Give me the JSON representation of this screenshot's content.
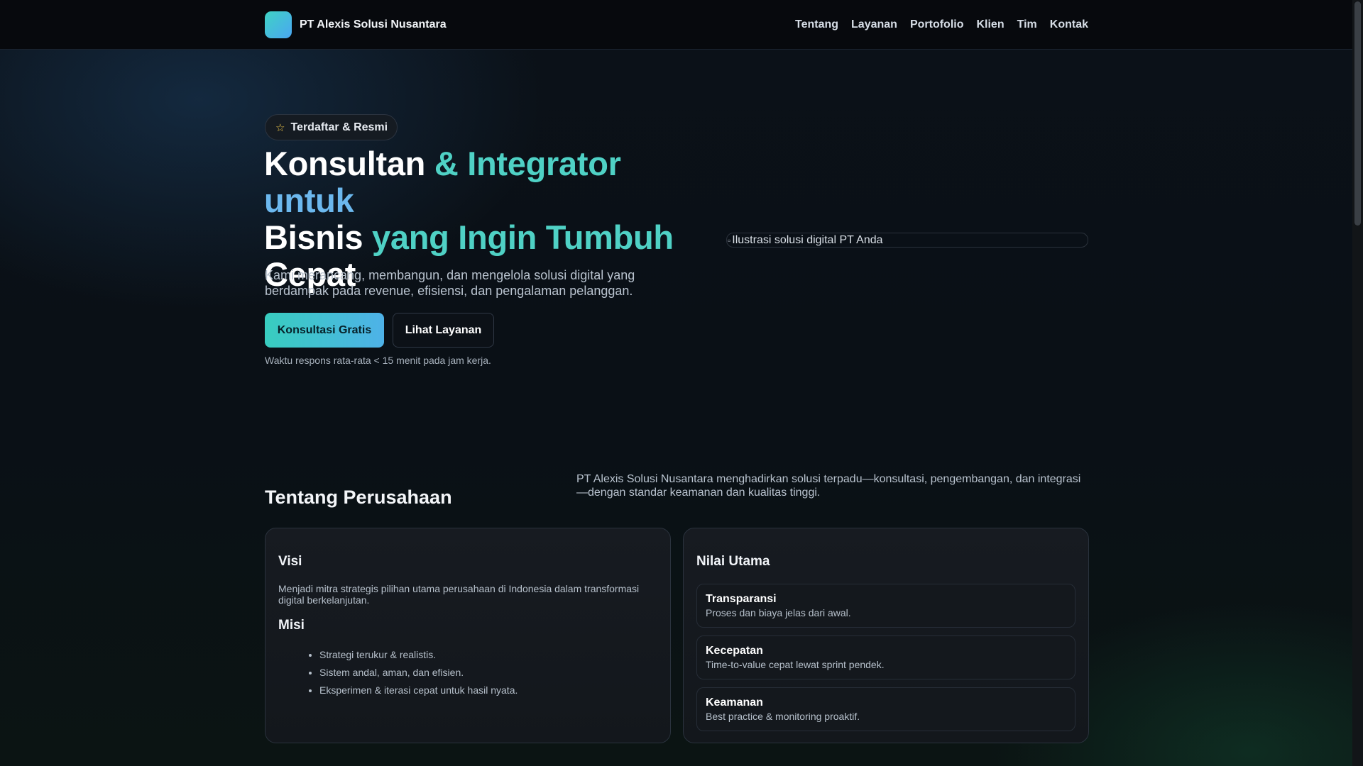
{
  "header": {
    "brand_name": "PT Alexis Solusi Nusantara",
    "nav": [
      "Tentang",
      "Layanan",
      "Portofolio",
      "Klien",
      "Tim",
      "Kontak"
    ]
  },
  "hero": {
    "badge": "Terdaftar & Resmi",
    "title": {
      "w1": "Konsultan",
      "g1": "& Integrator",
      "gb1": "untuk",
      "w2": "Bisnis",
      "g2": "yang Ingin Tumbuh",
      "w3": "Cepat"
    },
    "subtitle": "Kami merancang, membangun, dan mengelola solusi digital yang berdampak pada revenue, efisiensi, dan pengalaman pelanggan.",
    "primary_cta": "Konsultasi Gratis",
    "secondary_cta": "Lihat Layanan",
    "note": "Waktu respons rata-rata < 15 menit pada jam kerja.",
    "image_alt": "Ilustrasi solusi digital PT Anda"
  },
  "about": {
    "title": "Tentang Perusahaan",
    "description": "PT Alexis Solusi Nusantara menghadirkan solusi terpadu—konsultasi, pengembangan, dan integrasi—dengan standar keamanan dan kualitas tinggi.",
    "vision_title": "Visi",
    "vision_text": "Menjadi mitra strategis pilihan utama perusahaan di Indonesia dalam transformasi digital berkelanjutan.",
    "mission_title": "Misi",
    "mission_items": [
      "Strategi terukur & realistis.",
      "Sistem andal, aman, dan efisien.",
      "Eksperimen & iterasi cepat untuk hasil nyata."
    ],
    "values_title": "Nilai Utama",
    "values": [
      {
        "title": "Transparansi",
        "desc": "Proses dan biaya jelas dari awal."
      },
      {
        "title": "Kecepatan",
        "desc": "Time-to-value cepat lewat sprint pendek."
      },
      {
        "title": "Keamanan",
        "desc": "Best practice & monitoring proaktif."
      }
    ]
  },
  "icons": {
    "badge": "star-icon",
    "hero_image": "broken-image-icon"
  },
  "colors": {
    "accent_teal": "#4fd1c5",
    "accent_blue": "#6cb8ee",
    "star": "#f1c84a"
  }
}
